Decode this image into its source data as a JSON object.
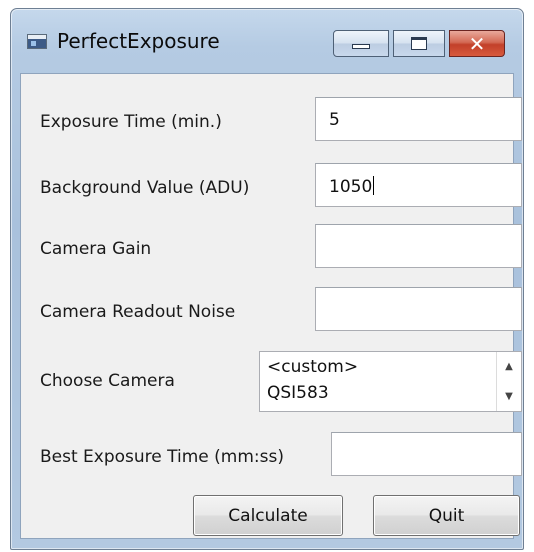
{
  "window": {
    "title": "PerfectExposure"
  },
  "form": {
    "exposure_time": {
      "label": "Exposure Time (min.)",
      "value": "5"
    },
    "background_value": {
      "label": "Background Value (ADU)",
      "value": "1050"
    },
    "camera_gain": {
      "label": "Camera Gain",
      "value": ""
    },
    "readout_noise": {
      "label": "Camera Readout Noise",
      "value": ""
    },
    "camera": {
      "label": "Choose Camera",
      "options": [
        "<custom>",
        "QSI583"
      ]
    },
    "best_exposure": {
      "label": "Best Exposure Time (mm:ss)",
      "value": ""
    }
  },
  "buttons": {
    "calculate": "Calculate",
    "quit": "Quit"
  },
  "icons": {
    "app": "app-window-icon",
    "minimize": "minimize-icon",
    "maximize": "maximize-icon",
    "close": "close-icon",
    "spin_up": "arrow-up-icon",
    "spin_down": "arrow-down-icon"
  },
  "colors": {
    "close_button": "#c8452e",
    "frame": "#b5cbe3"
  }
}
